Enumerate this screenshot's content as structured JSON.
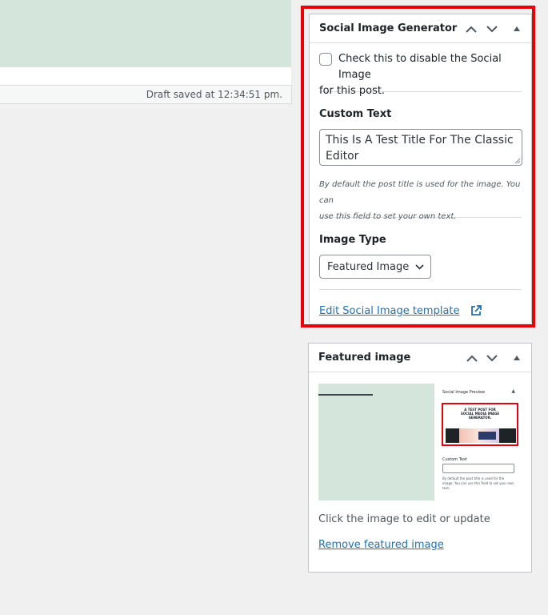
{
  "editor": {
    "status": "Draft saved at 12:34:51 pm."
  },
  "social_image_box": {
    "title": "Social Image Generator",
    "disable_checkbox_label_line1": "Check this to disable the Social Image",
    "disable_checkbox_label_line2": "for this post.",
    "disable_checked": false,
    "custom_text_label": "Custom Text",
    "custom_text_value": "This Is A Test Title For The Classic Editor",
    "help_line1": "By default the post title is used for the image. You can",
    "help_line2": "use this field to set your own text.",
    "image_type_label": "Image Type",
    "image_type_selected": "Featured Image",
    "template_link": "Edit Social Image template"
  },
  "featured_image_box": {
    "title": "Featured image",
    "thumbnail": {
      "panel_title": "Social Image Preview",
      "image_title": "A TEST POST FOR SOCIAL MEDIA IMAGE GENERATOR.",
      "custom_text_label": "Custom Text",
      "help": "By default the post title is used for the image. You can use this field to set your own text."
    },
    "caption": "Click the image to edit or update",
    "remove_link": "Remove featured image"
  },
  "colors": {
    "highlight": "#e8000b",
    "link": "#2271b1",
    "editor_bg": "#d4e6dc"
  }
}
